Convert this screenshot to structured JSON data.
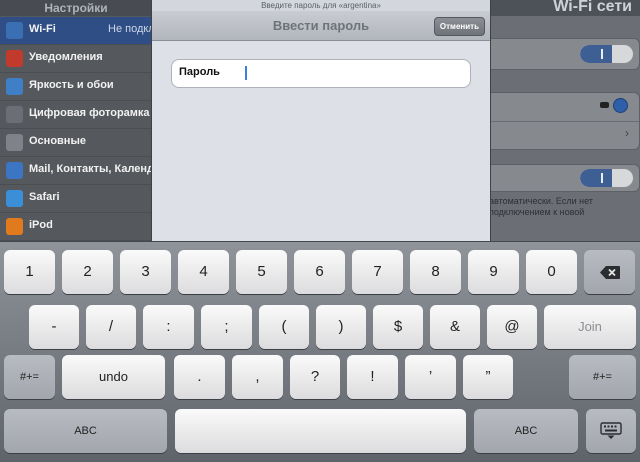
{
  "sidebar": {
    "title": "Настройки",
    "items": [
      {
        "label": "Wi-Fi",
        "value": "Не подключено",
        "icon": "wifi-icon",
        "color": "#3a6fb3"
      },
      {
        "label": "Уведомления",
        "icon": "notifications-icon",
        "color": "#c23a2c"
      },
      {
        "label": "Яркость и обои",
        "icon": "brightness-icon",
        "color": "#3f7fc6"
      },
      {
        "label": "Цифровая фоторамка",
        "icon": "photo-frame-icon",
        "color": "#6b6f75"
      },
      {
        "label": "Основные",
        "icon": "gear-icon",
        "color": "#7f8389"
      },
      {
        "label": "Mail, Контакты, Календари",
        "icon": "mail-icon",
        "color": "#3c76c2"
      },
      {
        "label": "Safari",
        "icon": "safari-icon",
        "color": "#3b8fd6"
      },
      {
        "label": "iPod",
        "icon": "ipod-icon",
        "color": "#e07a1c"
      }
    ]
  },
  "detail": {
    "header_text": "Wi-Fi сети",
    "note_text": "автоматически. Если нет подключением к новой"
  },
  "modal": {
    "subtitle": "Введите пароль для «argentina»",
    "title": "Ввести пароль",
    "cancel_label": "Отменить",
    "password_label": "Пароль",
    "password_value": ""
  },
  "keyboard": {
    "row1": [
      "1",
      "2",
      "3",
      "4",
      "5",
      "6",
      "7",
      "8",
      "9",
      "0"
    ],
    "delete_icon": "backspace-icon",
    "row2": [
      "-",
      "/",
      ":",
      ";",
      "(",
      ")",
      "$",
      "&",
      "@"
    ],
    "join_label": "Join",
    "row3_left": "#+=",
    "undo_label": "undo",
    "row3": [
      ".",
      ",",
      "?",
      "!",
      "’",
      "”"
    ],
    "row3_right": "#+=",
    "abc_left": "ABC",
    "space_label": "",
    "abc_right": "ABC",
    "hide_icon": "keyboard-hide-icon"
  }
}
